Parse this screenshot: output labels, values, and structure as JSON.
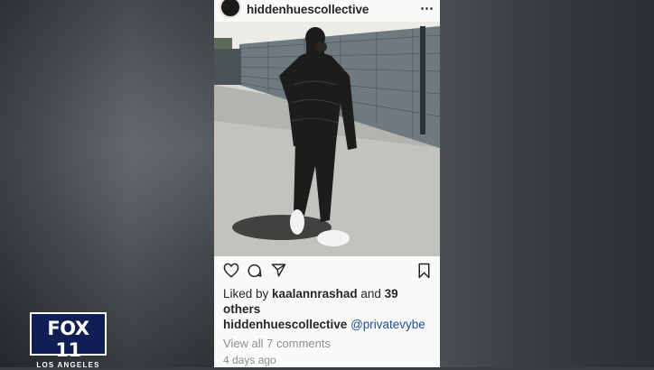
{
  "post": {
    "username": "hiddenhuescollective",
    "more_icon": "more-horizontal-icon",
    "liked_prefix": "Liked by ",
    "liked_user": "kaalannrashad",
    "liked_and": " and ",
    "liked_count": "39",
    "liked_others": "others",
    "caption_user": "hiddenhuescollective",
    "caption_mention": "@privatevybe",
    "view_comments": "View all 7 comments",
    "time_ago": "4 days ago"
  },
  "actions": {
    "like_icon": "heart-icon",
    "comment_icon": "comment-icon",
    "share_icon": "share-icon",
    "save_icon": "bookmark-icon"
  },
  "broadcast": {
    "logo_main": "FOX 11",
    "logo_sub": "LOS ANGELES"
  }
}
